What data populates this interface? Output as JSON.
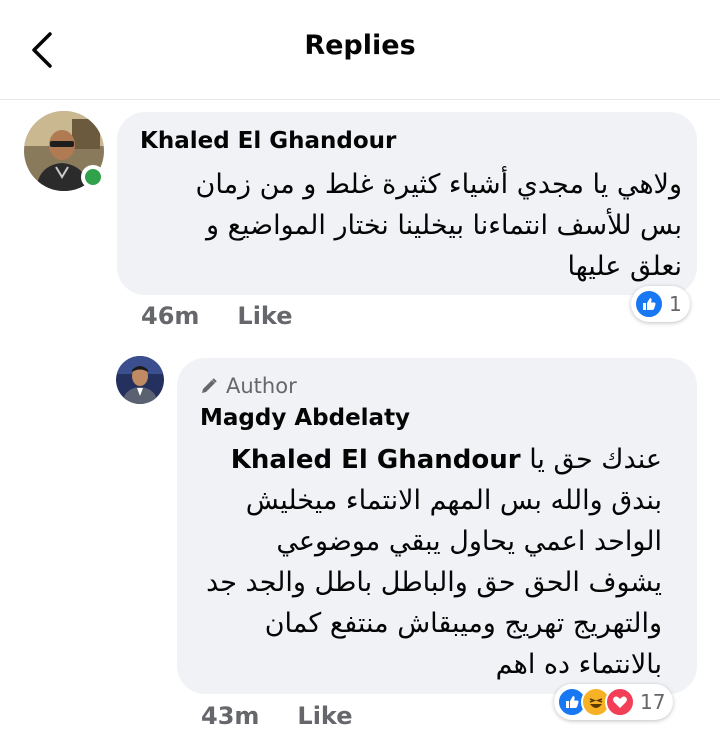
{
  "header": {
    "title": "Replies"
  },
  "comments": [
    {
      "author": "Khaled El Ghandour",
      "lines": [
        "ولاهي يا مجدي أشياء كثيرة غلط و من زمان",
        "بس للأسف انتماءنا بيخلينا نختار المواضيع و",
        "نعلق عليها"
      ],
      "time": "46m",
      "like_label": "Like",
      "reaction_count": "1",
      "reactions": [
        "like-icon"
      ],
      "online": true
    },
    {
      "badge": "Author",
      "author": "Magdy Abdelaty",
      "mention": "Khaled El Ghandour",
      "first_line_prefix": "عندك حق يا",
      "lines": [
        "بندق والله بس المهم الانتماء ميخليش",
        "الواحد اعمي يحاول يبقي موضوعي",
        "يشوف الحق حق والباطل باطل والجد جد",
        "والتهريج تهريج وميبقاش منتفع كمان",
        "بالانتماء ده اهم"
      ],
      "time": "43m",
      "like_label": "Like",
      "reaction_count": "17",
      "reactions": [
        "like-icon",
        "haha-icon",
        "love-icon"
      ]
    }
  ],
  "colors": {
    "bubble": "#f0f2f5",
    "meta_text": "#65676b",
    "like_blue": "#1877f2",
    "love_red": "#f33e58",
    "haha_yellow": "#f7b125",
    "online_green": "#31a24c"
  }
}
